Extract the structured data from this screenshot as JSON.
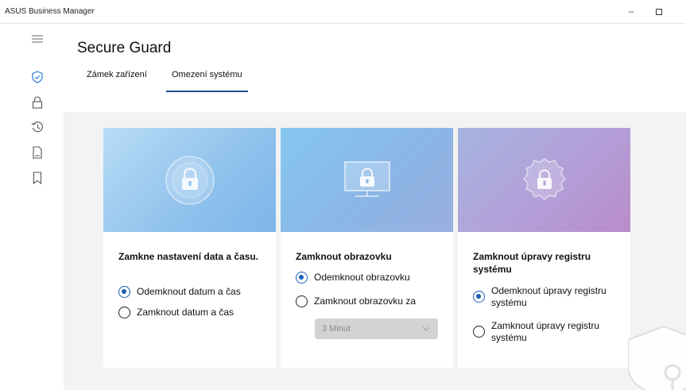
{
  "window": {
    "title": "ASUS Business Manager",
    "minimize_icon": "minimize-icon",
    "maximize_icon": "maximize-icon"
  },
  "sidebar": {
    "items": [
      {
        "icon": "hamburger-menu-icon"
      },
      {
        "icon": "shield-check-icon",
        "active": true
      },
      {
        "icon": "lock-icon"
      },
      {
        "icon": "history-icon"
      },
      {
        "icon": "document-icon"
      },
      {
        "icon": "bookmark-icon"
      }
    ]
  },
  "page": {
    "title": "Secure Guard",
    "tabs": [
      {
        "label": "Zámek zařízení"
      },
      {
        "label": "Omezení systému",
        "active": true
      }
    ]
  },
  "cards": [
    {
      "title": "Zamkne nastavení data a času.",
      "options": [
        {
          "label": "Odemknout datum a čas",
          "checked": true
        },
        {
          "label": "Zamknout datum a čas",
          "checked": false
        }
      ]
    },
    {
      "title": "Zamknout obrazovku",
      "options": [
        {
          "label": "Odemknout obrazovku",
          "checked": true
        },
        {
          "label": "Zamknout obrazovku za",
          "checked": false
        }
      ],
      "dropdown": {
        "value": "3 Minut",
        "enabled": false
      }
    },
    {
      "title": "Zamknout úpravy registru systému",
      "options": [
        {
          "label": "Odemknout úpravy registru systému",
          "checked": true
        },
        {
          "label": "Zamknout úpravy registru systému",
          "checked": false
        }
      ]
    }
  ],
  "colors": {
    "accent": "#1a5fb4",
    "tab_underline": "#1e4f8f"
  }
}
